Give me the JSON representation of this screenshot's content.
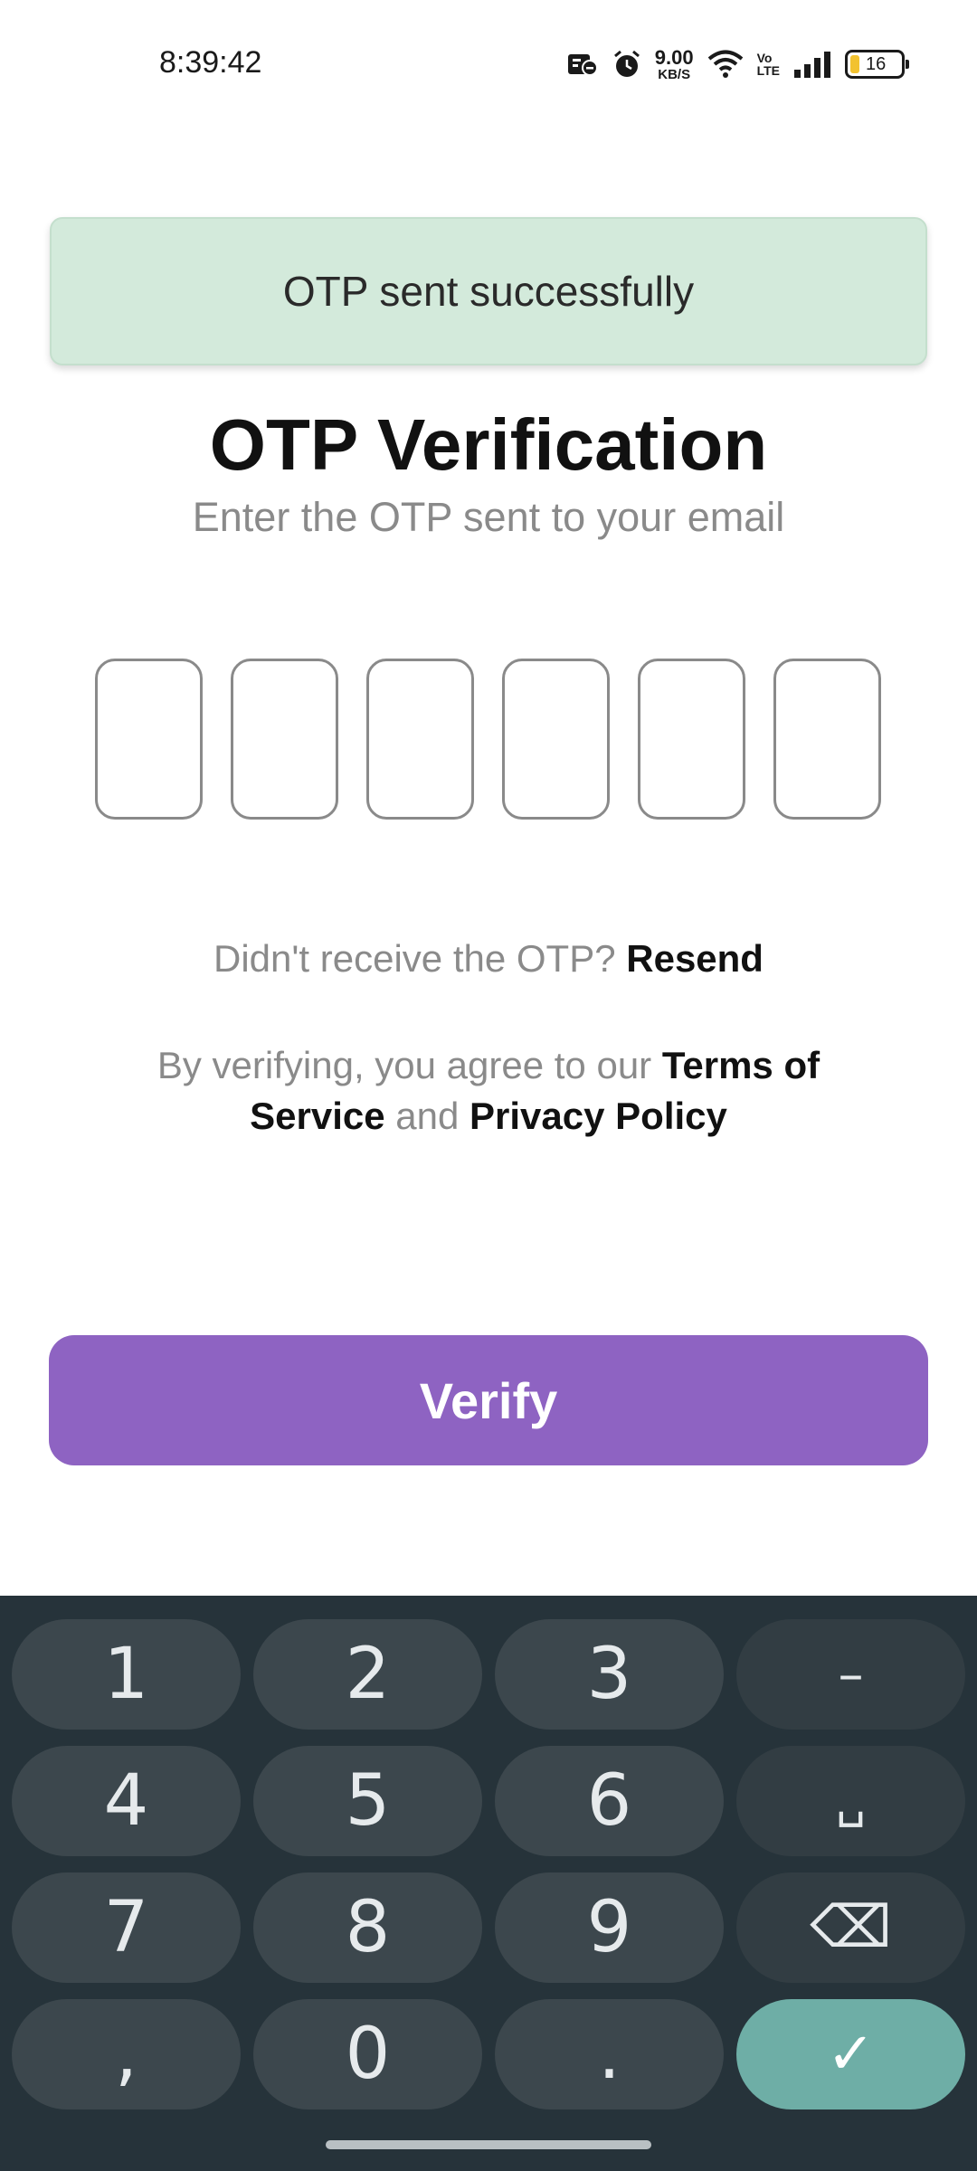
{
  "status_bar": {
    "time": "8:39:42",
    "net_speed_value": "9.00",
    "net_speed_unit": "KB/S",
    "volte_top": "Vo",
    "volte_bottom": "LTE",
    "battery_level": "16",
    "battery_fraction": 0.16,
    "icons": [
      "notification-icon",
      "alarm-icon",
      "wifi-icon",
      "signal-icon",
      "battery-icon"
    ]
  },
  "toast": {
    "message": "OTP sent successfully",
    "background": "#d3eadb"
  },
  "header": {
    "title": "OTP Verification",
    "subtitle": "Enter the OTP sent to your email"
  },
  "otp": {
    "digits": [
      "",
      "",
      "",
      "",
      "",
      ""
    ]
  },
  "resend": {
    "prompt": "Didn't receive the OTP?",
    "link": "Resend"
  },
  "terms": {
    "prefix": "By verifying, you agree to our",
    "terms_link": "Terms of Service",
    "conjunction": "and",
    "privacy_link": "Privacy Policy"
  },
  "verify_button": {
    "label": "Verify",
    "color": "#8e63c2"
  },
  "keyboard": {
    "rows": [
      [
        "1",
        "2",
        "3",
        "–"
      ],
      [
        "4",
        "5",
        "6",
        "␣"
      ],
      [
        "7",
        "8",
        "9",
        "⌫"
      ],
      [
        ",",
        "0",
        ".",
        "✓"
      ]
    ],
    "enter_color": "#6eaea6"
  }
}
